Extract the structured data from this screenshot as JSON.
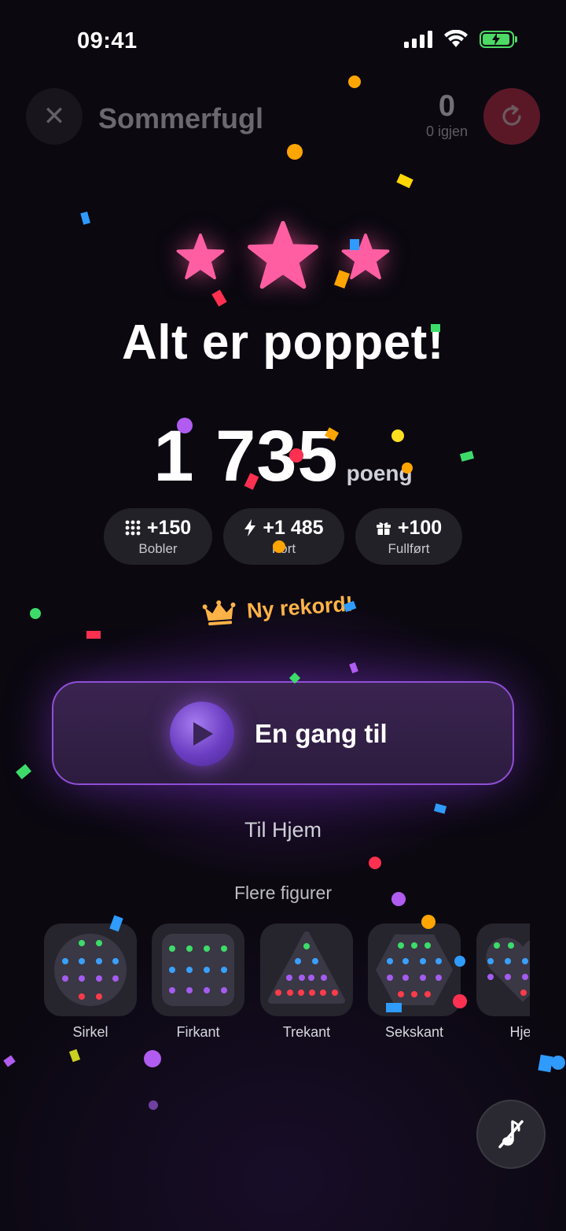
{
  "status_bar": {
    "time": "09:41"
  },
  "header": {
    "close_icon": "close-icon",
    "title": "Sommerfugl",
    "score": "0",
    "remaining": "0 igjen",
    "replay_icon": "replay-icon"
  },
  "result": {
    "stars_earned": 3,
    "headline": "Alt er poppet!",
    "score": "1 735",
    "score_unit": "poeng"
  },
  "breakdown": [
    {
      "icon": "bubbles-grid-icon",
      "value": "+150",
      "label": "Bobler"
    },
    {
      "icon": "lightning-icon",
      "value": "+1 485",
      "label": "Fort"
    },
    {
      "icon": "gift-icon",
      "value": "+100",
      "label": "Fullført"
    }
  ],
  "record": {
    "icon": "crown-icon",
    "text": "Ny rekord!"
  },
  "actions": {
    "play_again": "En gang til",
    "home": "Til Hjem"
  },
  "more_shapes": {
    "heading": "Flere figurer",
    "items": [
      {
        "name": "Sirkel"
      },
      {
        "name": "Firkant"
      },
      {
        "name": "Trekant"
      },
      {
        "name": "Sekskant"
      },
      {
        "name": "Hjer"
      }
    ]
  },
  "colors": {
    "background": "#0b0810",
    "star": "#ff5fa2",
    "accent_purple": "#8f4fd6",
    "record_orange": "#ffb347",
    "replay_red": "#c83045"
  }
}
